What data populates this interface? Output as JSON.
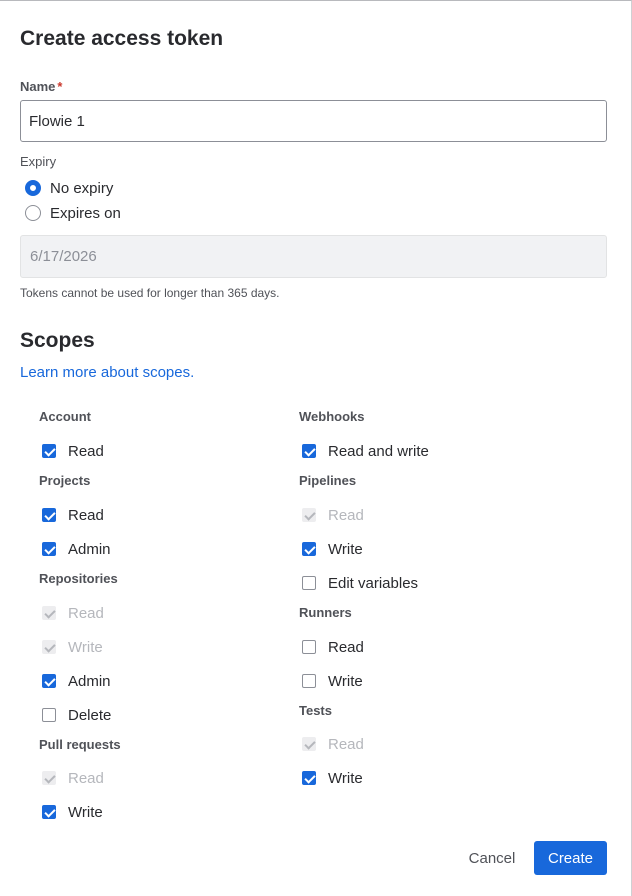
{
  "dialog": {
    "title": "Create access token"
  },
  "name_field": {
    "label": "Name",
    "required_mark": "*",
    "value": "Flowie 1"
  },
  "expiry": {
    "label": "Expiry",
    "options": [
      {
        "label": "No expiry",
        "selected": true
      },
      {
        "label": "Expires on",
        "selected": false
      }
    ],
    "date_value": "6/17/2026",
    "helper": "Tokens cannot be used for longer than 365 days."
  },
  "scopes": {
    "heading": "Scopes",
    "learn_more": "Learn more about scopes.",
    "left": [
      {
        "group": "Account",
        "items": [
          {
            "label": "Read",
            "state": "checked"
          }
        ]
      },
      {
        "group": "Projects",
        "items": [
          {
            "label": "Read",
            "state": "checked"
          },
          {
            "label": "Admin",
            "state": "checked"
          }
        ]
      },
      {
        "group": "Repositories",
        "items": [
          {
            "label": "Read",
            "state": "disabled"
          },
          {
            "label": "Write",
            "state": "disabled"
          },
          {
            "label": "Admin",
            "state": "checked"
          },
          {
            "label": "Delete",
            "state": "unchecked"
          }
        ]
      },
      {
        "group": "Pull requests",
        "items": [
          {
            "label": "Read",
            "state": "disabled"
          },
          {
            "label": "Write",
            "state": "checked"
          }
        ]
      }
    ],
    "right": [
      {
        "group": "Webhooks",
        "items": [
          {
            "label": "Read and write",
            "state": "checked"
          }
        ]
      },
      {
        "group": "Pipelines",
        "items": [
          {
            "label": "Read",
            "state": "disabled"
          },
          {
            "label": "Write",
            "state": "checked"
          },
          {
            "label": "Edit variables",
            "state": "unchecked"
          }
        ]
      },
      {
        "group": "Runners",
        "items": [
          {
            "label": "Read",
            "state": "unchecked"
          },
          {
            "label": "Write",
            "state": "unchecked"
          }
        ]
      },
      {
        "group": "Tests",
        "items": [
          {
            "label": "Read",
            "state": "disabled"
          },
          {
            "label": "Write",
            "state": "checked"
          }
        ]
      }
    ]
  },
  "footer": {
    "cancel_label": "Cancel",
    "create_label": "Create"
  },
  "colors": {
    "accent": "#1868db",
    "required": "#c9372c",
    "text": "#292a2e",
    "muted": "#505258",
    "disabled": "#b5b7bc"
  }
}
